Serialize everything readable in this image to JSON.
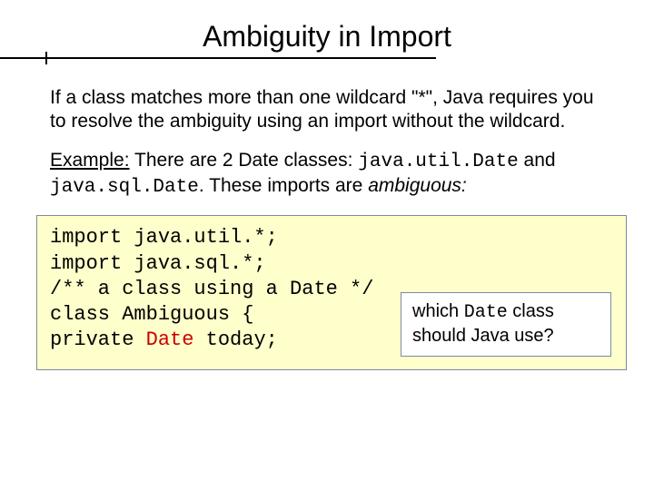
{
  "title": "Ambiguity in Import",
  "para1": "If a class matches more than one wildcard \"*\", Java requires you to resolve the ambiguity using an import without the wildcard.",
  "para2": {
    "lead": "Example:",
    "before_code1": " There are 2 Date classes: ",
    "code1": "java.util.Date",
    "mid": " and ",
    "code2": "java.sql.Date",
    "after": ".  These imports are ",
    "emph": "ambiguous:"
  },
  "code": {
    "l1": "import java.util.*;",
    "l2": "import java.sql.*;",
    "l3": "/** a class using a Date */",
    "l4": "class Ambiguous {",
    "l5a": "private ",
    "l5b": "Date",
    "l5c": " today;"
  },
  "callout": {
    "t1": "which ",
    "code": "Date",
    "t2": " class should Java use?"
  }
}
